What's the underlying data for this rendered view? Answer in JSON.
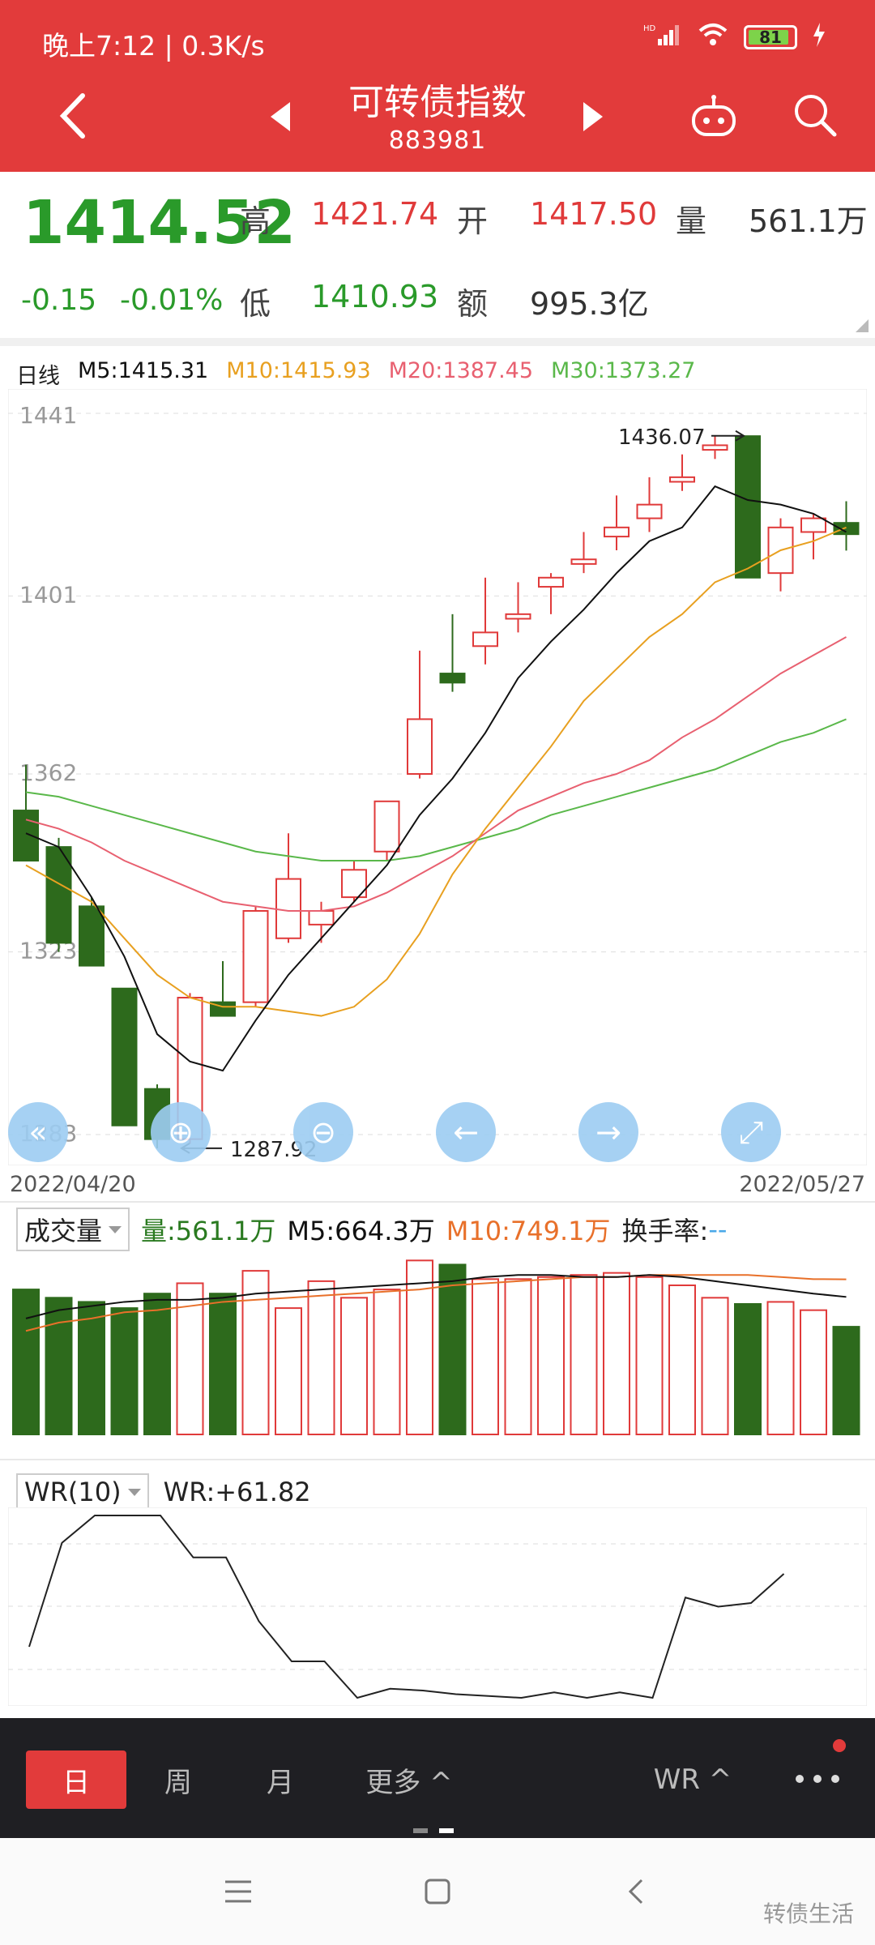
{
  "status": {
    "time": "晚上7:12 | 0.3K/s",
    "signal": "HD",
    "battery": "81"
  },
  "header": {
    "title": "可转债指数",
    "code": "883981"
  },
  "quote": {
    "price": "1414.52",
    "change": "-0.15",
    "change_pct": "-0.01%",
    "high_label": "高",
    "high": "1421.74",
    "open_label": "开",
    "open": "1417.50",
    "vol_label": "量",
    "vol": "561.1万",
    "low_label": "低",
    "low": "1410.93",
    "amt_label": "额",
    "amt": "995.3亿"
  },
  "ma_legend": {
    "period": "日线",
    "m5": "M5:1415.31",
    "m10": "M10:1415.93",
    "m20": "M20:1387.45",
    "m30": "M30:1373.27"
  },
  "colors": {
    "up": "#e03a3a",
    "down": "#2d6a1c",
    "m5": "#111111",
    "m10": "#e8a020",
    "m20": "#e86070",
    "m30": "#5ab84a"
  },
  "chart_data": {
    "type": "candlestick",
    "y_ticks": [
      "1441",
      "1401",
      "1362",
      "1323",
      "1283"
    ],
    "ylim": [
      1283,
      1441
    ],
    "date_start": "2022/04/20",
    "date_end": "2022/05/27",
    "high_marker": "1436.07",
    "low_marker": "1287.92",
    "candles": [
      {
        "o": 1354,
        "h": 1364,
        "l": 1343,
        "c": 1343
      },
      {
        "o": 1346,
        "h": 1348,
        "l": 1323,
        "c": 1325
      },
      {
        "o": 1333,
        "h": 1335,
        "l": 1320,
        "c": 1320
      },
      {
        "o": 1315,
        "h": 1315,
        "l": 1285,
        "c": 1285
      },
      {
        "o": 1293,
        "h": 1294,
        "l": 1280,
        "c": 1282
      },
      {
        "o": 1282,
        "h": 1314,
        "l": 1281,
        "c": 1313
      },
      {
        "o": 1312,
        "h": 1321,
        "l": 1310,
        "c": 1309
      },
      {
        "o": 1312,
        "h": 1333,
        "l": 1311,
        "c": 1332
      },
      {
        "o": 1326,
        "h": 1349,
        "l": 1325,
        "c": 1339
      },
      {
        "o": 1329,
        "h": 1334,
        "l": 1325,
        "c": 1332
      },
      {
        "o": 1335,
        "h": 1343,
        "l": 1334,
        "c": 1341
      },
      {
        "o": 1345,
        "h": 1351,
        "l": 1343,
        "c": 1356
      },
      {
        "o": 1362,
        "h": 1389,
        "l": 1361,
        "c": 1374
      },
      {
        "o": 1384,
        "h": 1397,
        "l": 1380,
        "c": 1382
      },
      {
        "o": 1390,
        "h": 1405,
        "l": 1386,
        "c": 1393
      },
      {
        "o": 1396,
        "h": 1404,
        "l": 1393,
        "c": 1397
      },
      {
        "o": 1403,
        "h": 1406,
        "l": 1397,
        "c": 1405
      },
      {
        "o": 1408,
        "h": 1415,
        "l": 1406,
        "c": 1409
      },
      {
        "o": 1414,
        "h": 1423,
        "l": 1411,
        "c": 1416
      },
      {
        "o": 1418,
        "h": 1427,
        "l": 1415,
        "c": 1421
      },
      {
        "o": 1426,
        "h": 1432,
        "l": 1424,
        "c": 1427
      },
      {
        "o": 1433,
        "h": 1436,
        "l": 1431,
        "c": 1434
      },
      {
        "o": 1436,
        "h": 1436.07,
        "l": 1405,
        "c": 1405
      },
      {
        "o": 1406,
        "h": 1418,
        "l": 1402,
        "c": 1416
      },
      {
        "o": 1415,
        "h": 1419,
        "l": 1409,
        "c": 1418
      },
      {
        "o": 1417,
        "h": 1421.74,
        "l": 1410.93,
        "c": 1414.52
      }
    ],
    "ma_m5": [
      1349,
      1346,
      1335,
      1322,
      1305,
      1299,
      1297,
      1308,
      1318,
      1326,
      1334,
      1342,
      1353,
      1361,
      1371,
      1383,
      1391,
      1398,
      1406,
      1413,
      1416,
      1425,
      1422,
      1421,
      1419,
      1415
    ],
    "ma_m10": [
      1342,
      1338,
      1334,
      1326,
      1318,
      1313,
      1311,
      1311,
      1310,
      1309,
      1311,
      1317,
      1327,
      1340,
      1350,
      1359,
      1368,
      1378,
      1385,
      1392,
      1397,
      1404,
      1407,
      1411,
      1413,
      1416
    ],
    "ma_m20": [
      1352,
      1350,
      1347,
      1343,
      1340,
      1337,
      1334,
      1333,
      1332,
      1332,
      1333,
      1336,
      1340,
      1344,
      1349,
      1354,
      1357,
      1360,
      1362,
      1365,
      1370,
      1374,
      1379,
      1384,
      1388,
      1392
    ],
    "ma_m30": [
      1358,
      1357,
      1355,
      1353,
      1351,
      1349,
      1347,
      1345,
      1344,
      1343,
      1343,
      1343,
      1344,
      1346,
      1348,
      1350,
      1353,
      1355,
      1357,
      1359,
      1361,
      1363,
      1366,
      1369,
      1371,
      1374
    ]
  },
  "volume": {
    "selector": "成交量",
    "vol": "量:561.1万",
    "m5": "M5:664.3万",
    "m10": "M10:749.1万",
    "turnover_label": "换手率:",
    "turnover_value": "--",
    "bars": [
      700,
      660,
      640,
      610,
      680,
      730,
      680,
      790,
      610,
      740,
      660,
      700,
      840,
      820,
      750,
      750,
      760,
      770,
      780,
      760,
      720,
      660,
      630,
      640,
      600,
      520
    ],
    "m5_line": [
      560,
      600,
      620,
      640,
      650,
      650,
      660,
      680,
      690,
      700,
      710,
      720,
      730,
      740,
      760,
      770,
      770,
      760,
      760,
      770,
      760,
      740,
      720,
      700,
      680,
      664
    ],
    "m10_line": [
      500,
      540,
      560,
      590,
      600,
      620,
      640,
      650,
      660,
      670,
      680,
      690,
      700,
      720,
      730,
      740,
      750,
      760,
      760,
      770,
      770,
      770,
      770,
      760,
      750,
      749
    ]
  },
  "wr": {
    "selector": "WR(10)",
    "value": "WR:+61.82",
    "series": [
      72,
      15,
      0,
      0,
      0,
      23,
      23,
      58,
      80,
      80,
      100,
      95,
      96,
      98,
      99,
      100,
      97,
      100,
      97,
      100,
      45,
      50,
      48,
      32
    ]
  },
  "toolbar": {
    "day": "日",
    "week": "周",
    "month": "月",
    "more": "更多 ^",
    "indicator": "WR ^"
  },
  "watermark": "转债生活"
}
